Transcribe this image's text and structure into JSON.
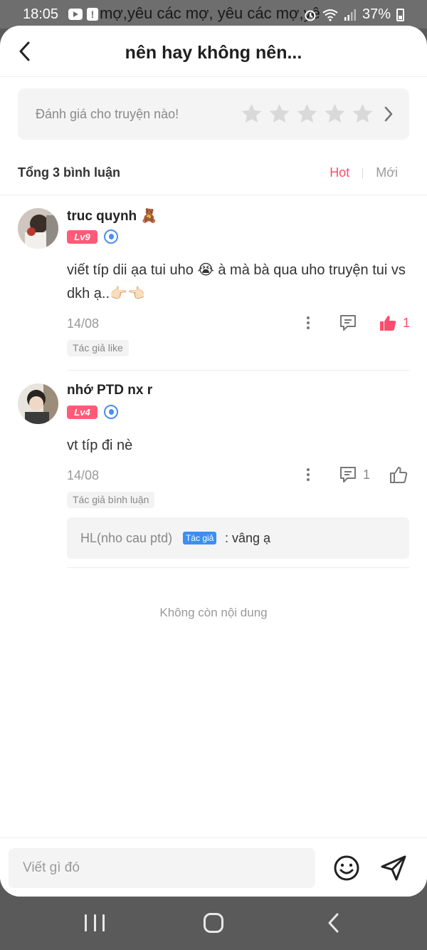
{
  "status_bar": {
    "time": "18:05",
    "background_text": "mợ,yêu các mợ, yêu các mợ,yê",
    "battery": "37%"
  },
  "header": {
    "title": "nên hay không nên..."
  },
  "rating": {
    "label": "Đánh giá cho truyện nào!",
    "star_count": 5,
    "star_color": "#d9d9d9"
  },
  "comments_header": {
    "total": "Tổng 3 bình luận",
    "tab_hot": "Hot",
    "tab_new": "Mới",
    "active_color": "#ff4d6d"
  },
  "comments": [
    {
      "username": "truc quynh",
      "username_emoji": "🧸",
      "level": "Lv9",
      "content": "viết típ dii ạa tui uho 😭 à mà bà qua uho truyện tui vs dkh ạ..👉🏻👈🏻",
      "date": "14/08",
      "reply_count": "",
      "like_count": "1",
      "liked": true,
      "tag": "Tác giả like"
    },
    {
      "username": "nhớ PTD nx r",
      "level": "Lv4",
      "content": "vt típ đi nè",
      "date": "14/08",
      "reply_count": "1",
      "like_count": "",
      "liked": false,
      "tag": "Tác giả bình luận",
      "reply": {
        "name": "HL(nho cau ptd)",
        "author_tag": "Tác giả",
        "text": ": vâng ạ"
      }
    }
  ],
  "footer_note": "Không còn nội dung",
  "composer": {
    "placeholder": "Viết gì đó"
  },
  "colors": {
    "accent": "#ff4d6d",
    "level_badge": "#ff5a78",
    "author_tag": "#3a8ef6"
  }
}
